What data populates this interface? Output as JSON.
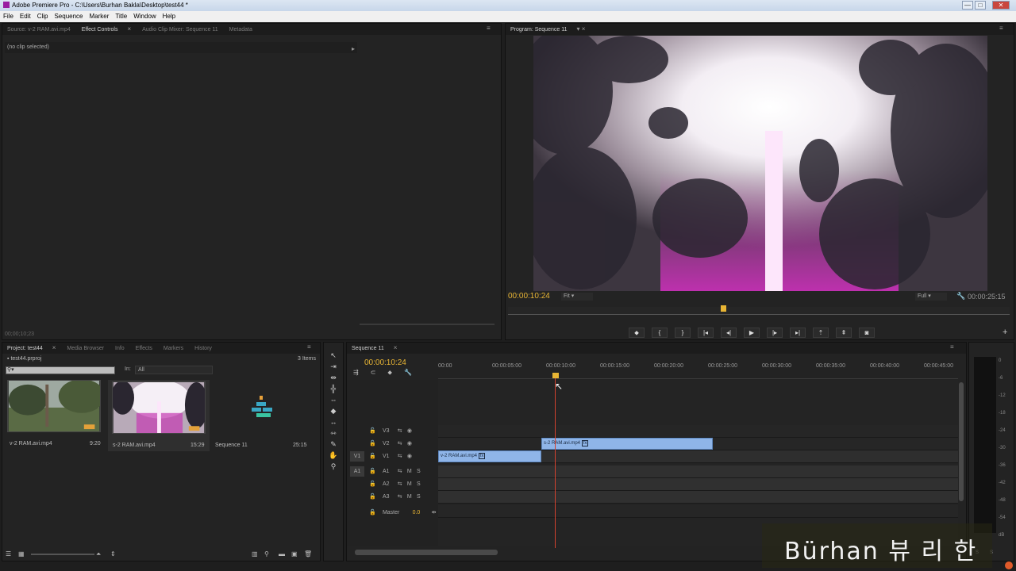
{
  "window": {
    "title": "Adobe Premiere Pro - C:\\Users\\Burhan Bakla\\Desktop\\test44 *",
    "min": "—",
    "max": "□",
    "close": "✕"
  },
  "menu": [
    "File",
    "Edit",
    "Clip",
    "Sequence",
    "Marker",
    "Title",
    "Window",
    "Help"
  ],
  "source_panel": {
    "tabs": [
      "Source: v-2 RAM.avi.mp4",
      "Effect Controls",
      "Audio Clip Mixer: Sequence 11",
      "Metadata"
    ],
    "active_tab": 1,
    "no_clip": "(no clip selected)",
    "timecode": "00;00;10;23"
  },
  "program_panel": {
    "tab": "Program: Sequence 11",
    "timecode": "00:00:10:24",
    "fit": "Fit",
    "quality": "Full",
    "duration": "00:00:25:15"
  },
  "project_panel": {
    "tabs": [
      "Project: test44",
      "Media Browser",
      "Info",
      "Effects",
      "Markers",
      "History"
    ],
    "file": "test44.prproj",
    "count": "3 Items",
    "in_label": "In:",
    "in_value": "All",
    "items": [
      {
        "name": "v-2 RAM.avi.mp4",
        "duration": "9:20"
      },
      {
        "name": "s-2 RAM.avi.mp4",
        "duration": "15:29"
      },
      {
        "name": "Sequence 11",
        "duration": "25:15"
      }
    ]
  },
  "timeline": {
    "tab": "Sequence 11",
    "timecode": "00:00:10:24",
    "ruler": [
      "00:00",
      "00:00:05:00",
      "00:00:10:00",
      "00:00:15:00",
      "00:00:20:00",
      "00:00:25:00",
      "00:00:30:00",
      "00:00:35:00",
      "00:00:40:00",
      "00:00:45:00"
    ],
    "video_tracks": [
      "V3",
      "V2",
      "V1"
    ],
    "audio_tracks": [
      "A1",
      "A2",
      "A3"
    ],
    "source_v": "V1",
    "source_a": "A1",
    "master": "Master",
    "master_val": "0.0",
    "clips": [
      {
        "track": "V2",
        "name": "s-2 RAM.avi.mp4",
        "fx": "fx"
      },
      {
        "track": "V1",
        "name": "v-2 RAM.avi.mp4",
        "fx": "fx"
      }
    ],
    "playhead_seconds": 10.96
  },
  "meters": {
    "labels": [
      "0",
      "-6",
      "-12",
      "-18",
      "-24",
      "-30",
      "-36",
      "-42",
      "-48",
      "-54",
      "dB"
    ],
    "s1": "S",
    "s2": "S"
  },
  "overlay": {
    "text": "Bürhan 뷰 리 한"
  },
  "colors": {
    "accent": "#e8b534",
    "clip": "#8fb5e8",
    "playhead": "#d2422f"
  }
}
